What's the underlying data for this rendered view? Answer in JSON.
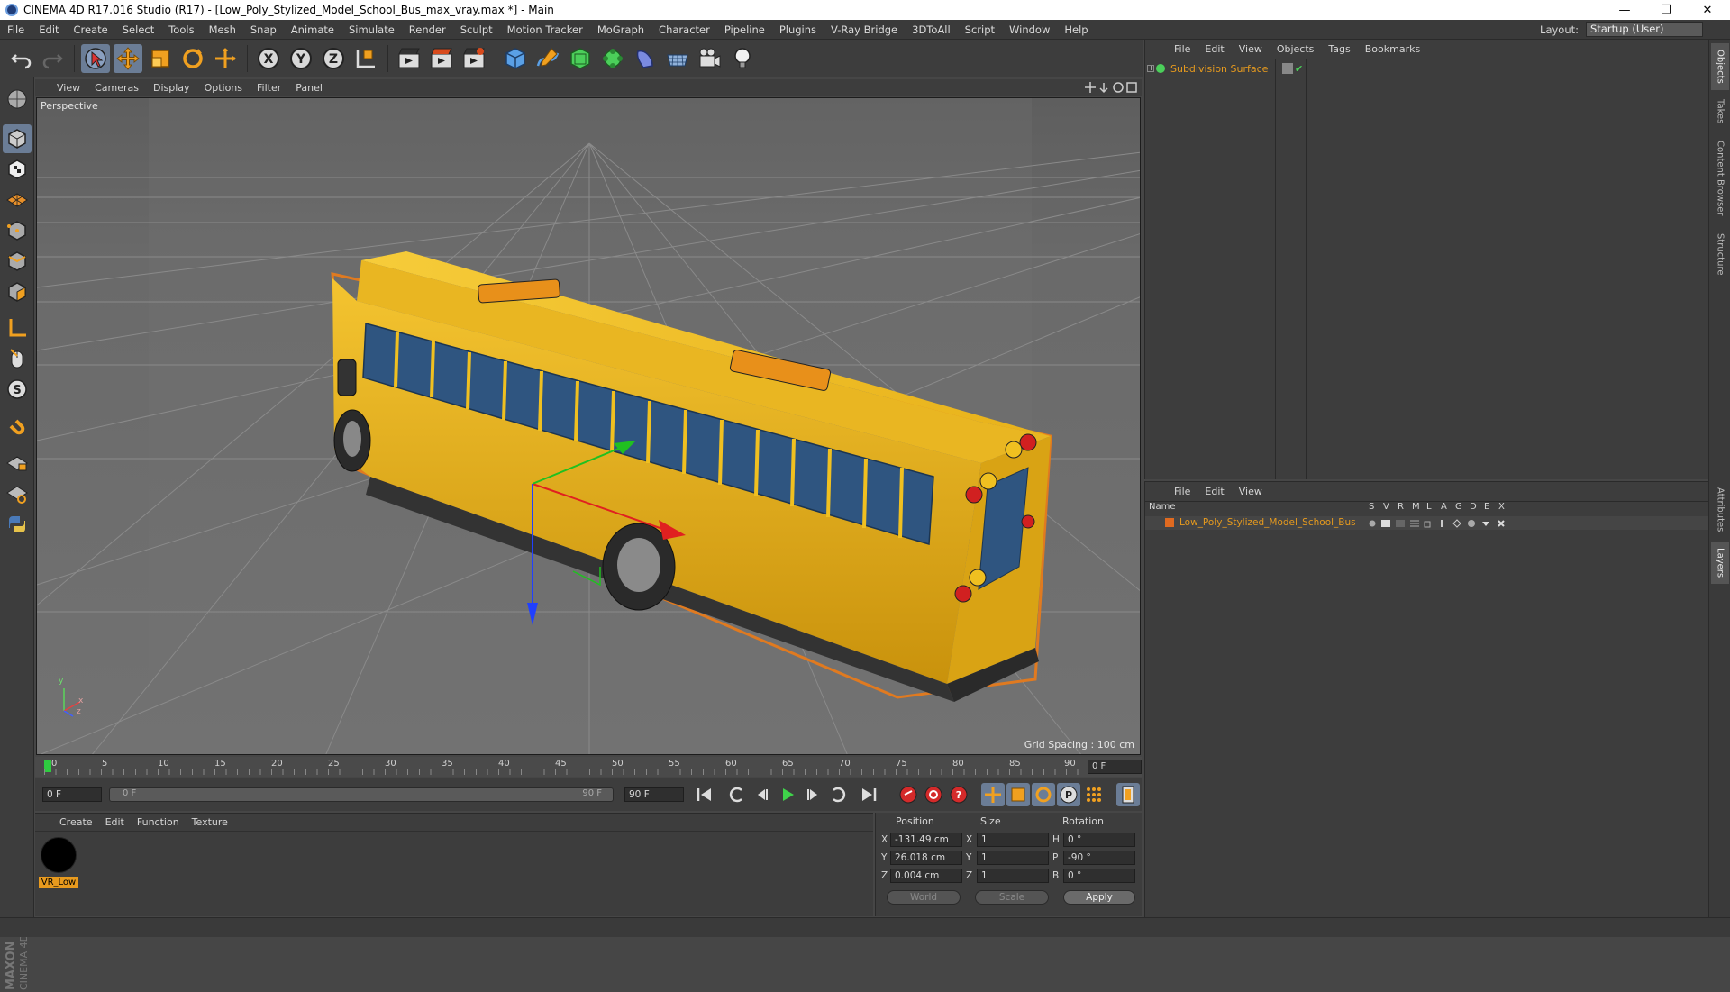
{
  "window": {
    "title": "CINEMA 4D R17.016 Studio (R17) - [Low_Poly_Stylized_Model_School_Bus_max_vray.max *] - Main",
    "minimize": "—",
    "restore": "❐",
    "close": "✕"
  },
  "menubar": {
    "items": [
      "File",
      "Edit",
      "Create",
      "Select",
      "Tools",
      "Mesh",
      "Snap",
      "Animate",
      "Simulate",
      "Render",
      "Sculpt",
      "Motion Tracker",
      "MoGraph",
      "Character",
      "Pipeline",
      "Plugins",
      "V-Ray Bridge",
      "3DToAll",
      "Script",
      "Window",
      "Help"
    ],
    "layout_label": "Layout:",
    "layout_value": "Startup (User)"
  },
  "viewport": {
    "menu": [
      "View",
      "Cameras",
      "Display",
      "Options",
      "Filter",
      "Panel"
    ],
    "label": "Perspective",
    "grid_spacing": "Grid Spacing : 100 cm",
    "axis_y": "y",
    "axis_z": "z",
    "axis_x": "x"
  },
  "timeline": {
    "ticks": [
      "0",
      "5",
      "10",
      "15",
      "20",
      "25",
      "30",
      "35",
      "40",
      "45",
      "50",
      "55",
      "60",
      "65",
      "70",
      "75",
      "80",
      "85",
      "90"
    ],
    "current_frame": "0 F"
  },
  "transport": {
    "start_frame": "0 F",
    "range_start": "0 F",
    "range_end": "90 F",
    "end_frame": "90 F"
  },
  "material_panel": {
    "menu": [
      "Create",
      "Edit",
      "Function",
      "Texture"
    ],
    "material_name": "VR_Low"
  },
  "coordinates": {
    "headers": [
      "Position",
      "Size",
      "Rotation"
    ],
    "rows": [
      {
        "axis": "X",
        "pos": "-131.49 cm",
        "saxis": "X",
        "size": "1",
        "raxis": "H",
        "rot": "0 °"
      },
      {
        "axis": "Y",
        "pos": "26.018 cm",
        "saxis": "Y",
        "size": "1",
        "raxis": "P",
        "rot": "-90 °"
      },
      {
        "axis": "Z",
        "pos": "0.004 cm",
        "saxis": "Z",
        "size": "1",
        "raxis": "B",
        "rot": "0 °"
      }
    ],
    "mode1": "World",
    "mode2": "Scale",
    "apply": "Apply"
  },
  "objects_panel": {
    "menu": [
      "File",
      "Edit",
      "View",
      "Objects",
      "Tags",
      "Bookmarks"
    ],
    "object_name": "Subdivision Surface"
  },
  "layers_panel": {
    "menu": [
      "File",
      "Edit",
      "View"
    ],
    "col_name": "Name",
    "cols": [
      "S",
      "V",
      "R",
      "M",
      "L",
      "A",
      "G",
      "D",
      "E",
      "X"
    ],
    "layer_name": "Low_Poly_Stylized_Model_School_Bus"
  },
  "side_tabs": [
    "Objects",
    "Takes",
    "Content Browser",
    "Structure",
    "Attributes",
    "Layers"
  ],
  "branding": {
    "maxon": "MAXON",
    "cinema": "CINEMA 4D"
  },
  "colors": {
    "accent": "#6b7d96",
    "object_orange": "#e69a1e",
    "bus_yellow": "#e8b21a",
    "selection_orange": "#e07a20"
  }
}
